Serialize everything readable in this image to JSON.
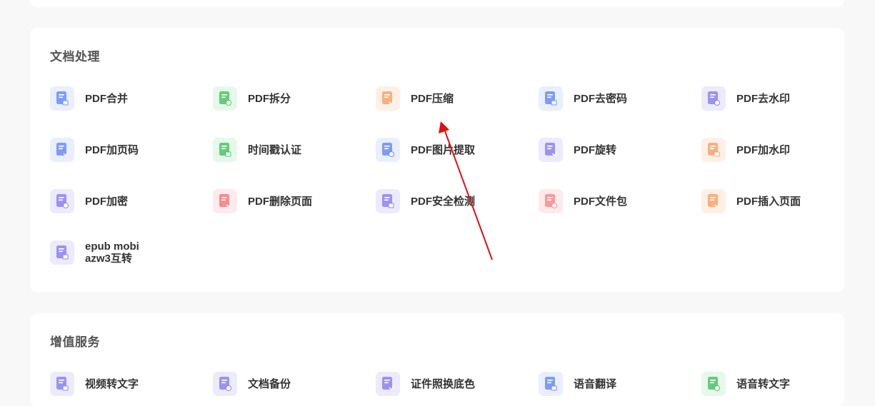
{
  "sections": {
    "doc": {
      "title": "文档处理",
      "tools": [
        {
          "label": "PDF合并",
          "icon": "pdf-merge-icon",
          "color": "#6b8cf6",
          "bg": "#e9efff"
        },
        {
          "label": "PDF拆分",
          "icon": "pdf-split-icon",
          "color": "#4cc36a",
          "bg": "#e6f8ea"
        },
        {
          "label": "PDF压缩",
          "icon": "pdf-compress-icon",
          "color": "#f7a46b",
          "bg": "#fff0e6"
        },
        {
          "label": "PDF去密码",
          "icon": "pdf-remove-password-icon",
          "color": "#6b8cf6",
          "bg": "#e9efff"
        },
        {
          "label": "PDF去水印",
          "icon": "pdf-remove-watermark-icon",
          "color": "#8c84f0",
          "bg": "#eceafd"
        },
        {
          "label": "PDF加页码",
          "icon": "pdf-add-page-number-icon",
          "color": "#6b8cf6",
          "bg": "#e9efff"
        },
        {
          "label": "时间戳认证",
          "icon": "timestamp-icon",
          "color": "#4cc36a",
          "bg": "#e6f8ea"
        },
        {
          "label": "PDF图片提取",
          "icon": "pdf-image-extract-icon",
          "color": "#6b8cf6",
          "bg": "#e9efff"
        },
        {
          "label": "PDF旋转",
          "icon": "pdf-rotate-icon",
          "color": "#8c84f0",
          "bg": "#eceafd"
        },
        {
          "label": "PDF加水印",
          "icon": "pdf-add-watermark-icon",
          "color": "#f7a46b",
          "bg": "#fff0e6"
        },
        {
          "label": "PDF加密",
          "icon": "pdf-encrypt-icon",
          "color": "#8c84f0",
          "bg": "#eceafd"
        },
        {
          "label": "PDF删除页面",
          "icon": "pdf-delete-page-icon",
          "color": "#f27c7c",
          "bg": "#fdeaea"
        },
        {
          "label": "PDF安全检测",
          "icon": "pdf-security-check-icon",
          "color": "#8c84f0",
          "bg": "#eceafd"
        },
        {
          "label": "PDF文件包",
          "icon": "pdf-package-icon",
          "color": "#f58c8c",
          "bg": "#fdeaea"
        },
        {
          "label": "PDF插入页面",
          "icon": "pdf-insert-page-icon",
          "color": "#f7a46b",
          "bg": "#fff0e6"
        },
        {
          "label": "epub mobi\nazw3互转",
          "icon": "ebook-convert-icon",
          "color": "#8c84f0",
          "bg": "#eceafd"
        }
      ]
    },
    "vas": {
      "title": "增值服务",
      "tools": [
        {
          "label": "视频转文字",
          "icon": "video-to-text-icon",
          "color": "#8c84f0",
          "bg": "#eceafd"
        },
        {
          "label": "文档备份",
          "icon": "doc-backup-icon",
          "color": "#8c84f0",
          "bg": "#eceafd"
        },
        {
          "label": "证件照换底色",
          "icon": "id-photo-icon",
          "color": "#8c84f0",
          "bg": "#eceafd"
        },
        {
          "label": "语音翻译",
          "icon": "voice-translate-icon",
          "color": "#6b8cf6",
          "bg": "#e9efff"
        },
        {
          "label": "语音转文字",
          "icon": "speech-to-text-icon",
          "color": "#4cc36a",
          "bg": "#e6f8ea"
        }
      ]
    }
  },
  "annotation": {
    "type": "red-arrow",
    "color": "#e01010"
  }
}
